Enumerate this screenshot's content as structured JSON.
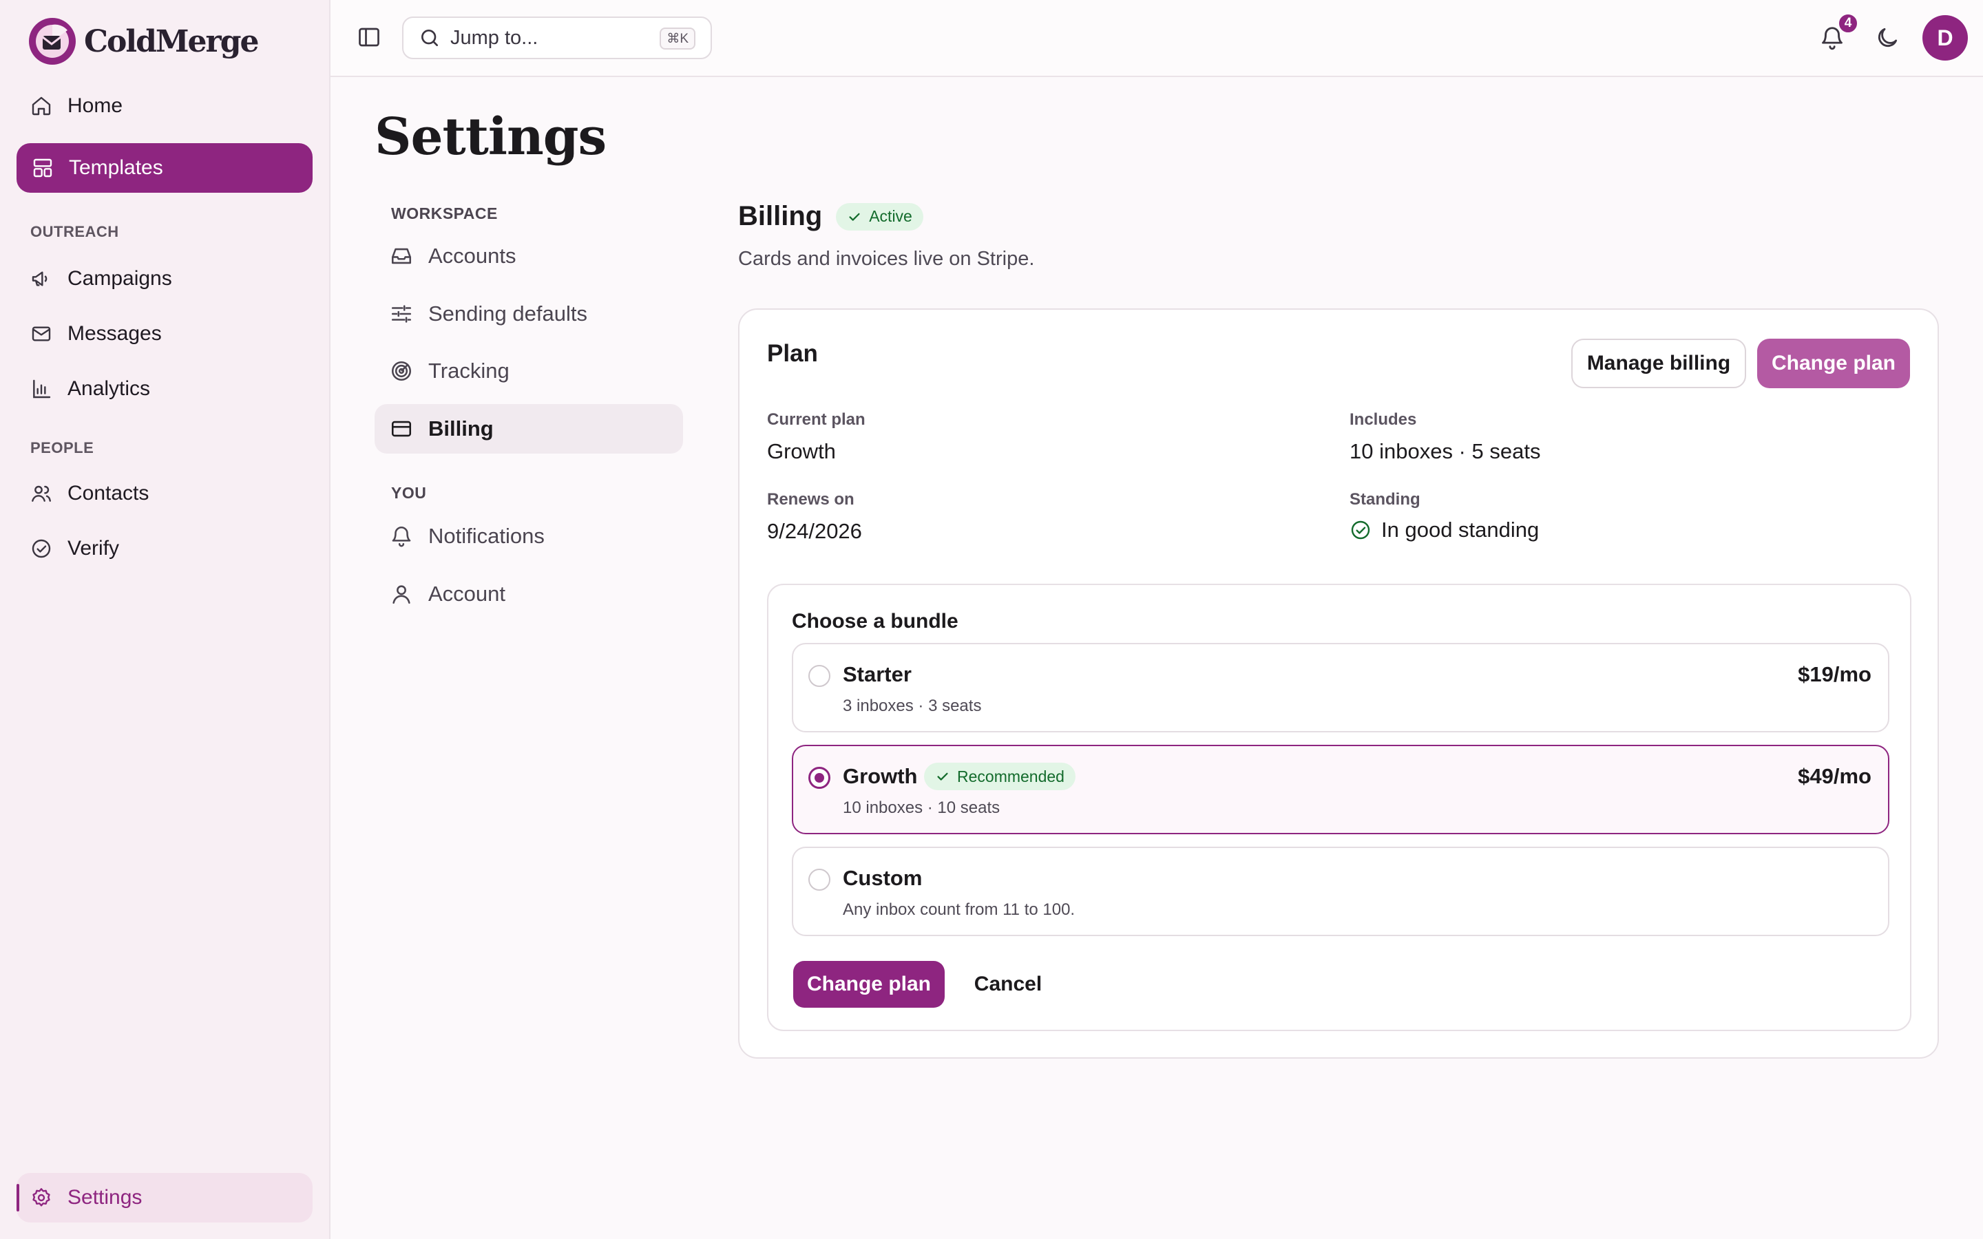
{
  "brand": {
    "name": "ColdMerge"
  },
  "sidebar": {
    "items_top": [
      {
        "label": "Home",
        "icon": "home-icon"
      },
      {
        "label": "Templates",
        "icon": "templates-icon",
        "active": true
      }
    ],
    "sections": [
      {
        "title": "OUTREACH",
        "items": [
          {
            "label": "Campaigns",
            "icon": "megaphone-icon"
          },
          {
            "label": "Messages",
            "icon": "mail-icon"
          },
          {
            "label": "Analytics",
            "icon": "bar-chart-icon"
          }
        ]
      },
      {
        "title": "PEOPLE",
        "items": [
          {
            "label": "Contacts",
            "icon": "users-icon"
          },
          {
            "label": "Verify",
            "icon": "check-circle-icon"
          }
        ]
      }
    ],
    "footer": {
      "label": "Settings",
      "icon": "gear-icon"
    }
  },
  "topbar": {
    "search_placeholder": "Jump to...",
    "shortcut": "⌘K",
    "notification_count": "4",
    "avatar_initial": "D"
  },
  "settings": {
    "title": "Settings",
    "nav": {
      "workspace_title": "WORKSPACE",
      "workspace_items": [
        "Accounts",
        "Sending defaults",
        "Tracking",
        "Billing"
      ],
      "you_title": "YOU",
      "you_items": [
        "Notifications",
        "Account"
      ]
    }
  },
  "billing": {
    "title": "Billing",
    "status_badge": "Active",
    "subtitle": "Cards and invoices live on Stripe.",
    "plan_card": {
      "title": "Plan",
      "manage_label": "Manage billing",
      "change_label": "Change plan",
      "current_plan_label": "Current plan",
      "current_plan_value": "Growth",
      "includes_label": "Includes",
      "includes_value": "10 inboxes · 5 seats",
      "renews_label": "Renews on",
      "renews_value": "9/24/2026",
      "standing_label": "Standing",
      "standing_value": "In good standing"
    },
    "bundle": {
      "title": "Choose a bundle",
      "options": [
        {
          "name": "Starter",
          "desc": "3 inboxes · 3 seats",
          "price": "$19/mo",
          "selected": false
        },
        {
          "name": "Growth",
          "desc": "10 inboxes · 10 seats",
          "price": "$49/mo",
          "badge": "Recommended",
          "selected": true
        },
        {
          "name": "Custom",
          "desc": "Any inbox count from 11 to 100.",
          "price": "",
          "selected": false
        }
      ],
      "submit_label": "Change plan",
      "cancel_label": "Cancel"
    }
  },
  "colors": {
    "accent": "#8e2580",
    "accent_soft": "#b45aa3",
    "success": "#136b2c",
    "success_bg": "#e2f5e6"
  }
}
